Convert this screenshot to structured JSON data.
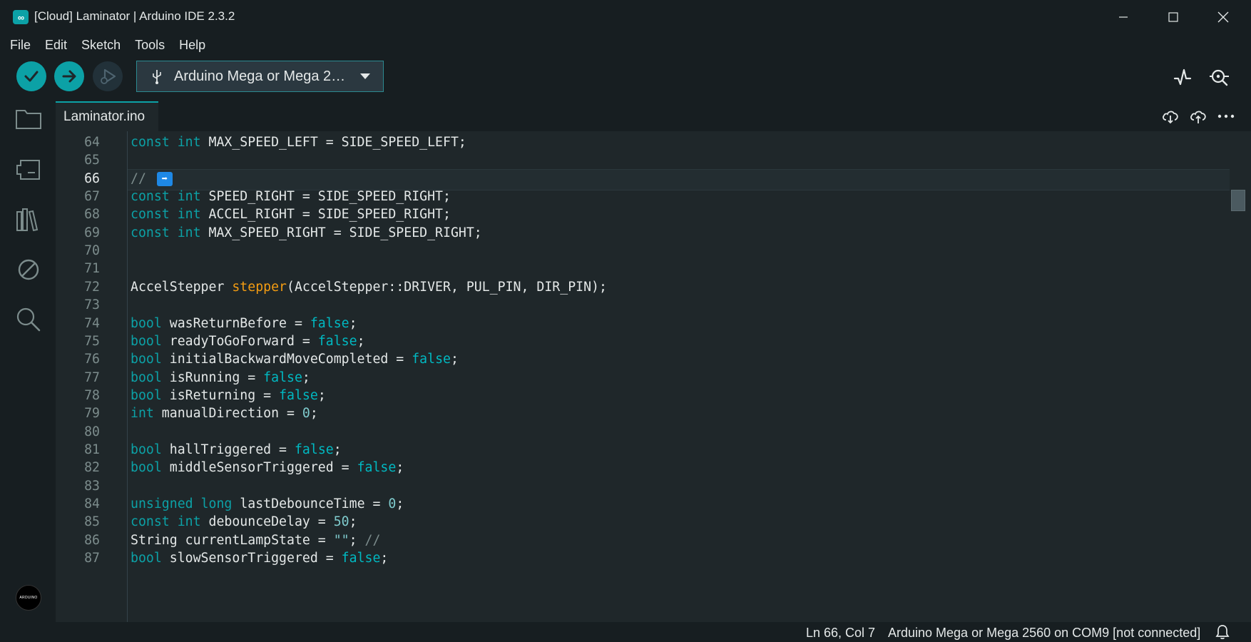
{
  "window": {
    "title": "[Cloud] Laminator | Arduino IDE 2.3.2",
    "app_icon_glyph": "∞"
  },
  "menu": [
    "File",
    "Edit",
    "Sketch",
    "Tools",
    "Help"
  ],
  "toolbar": {
    "board_label": "Arduino Mega or Mega 2…",
    "verify_icon": "check-icon",
    "upload_icon": "arrow-right-icon",
    "debug_icon": "debug-icon",
    "accent_color": "#0ca1a6"
  },
  "sidebar": {
    "items": [
      "folder-icon",
      "board-manager-icon",
      "library-manager-icon",
      "debug-disabled-icon",
      "search-icon"
    ],
    "avatar_text": "ARDUINO"
  },
  "tabs": [
    {
      "label": "Laminator.ino"
    }
  ],
  "editor": {
    "current_line": 66,
    "lines": [
      {
        "n": "64",
        "tokens": [
          [
            "kw",
            "const"
          ],
          [
            "pl",
            " "
          ],
          [
            "kw",
            "int"
          ],
          [
            "pl",
            " MAX_SPEED_LEFT = SIDE_SPEED_LEFT;"
          ]
        ]
      },
      {
        "n": "65",
        "tokens": []
      },
      {
        "n": "66",
        "tokens": [
          [
            "cm",
            "// "
          ]
        ],
        "emoji": "➡"
      },
      {
        "n": "67",
        "tokens": [
          [
            "kw",
            "const"
          ],
          [
            "pl",
            " "
          ],
          [
            "kw",
            "int"
          ],
          [
            "pl",
            " SPEED_RIGHT = SIDE_SPEED_RIGHT;"
          ]
        ]
      },
      {
        "n": "68",
        "tokens": [
          [
            "kw",
            "const"
          ],
          [
            "pl",
            " "
          ],
          [
            "kw",
            "int"
          ],
          [
            "pl",
            " ACCEL_RIGHT = SIDE_SPEED_RIGHT;"
          ]
        ]
      },
      {
        "n": "69",
        "tokens": [
          [
            "kw",
            "const"
          ],
          [
            "pl",
            " "
          ],
          [
            "kw",
            "int"
          ],
          [
            "pl",
            " MAX_SPEED_RIGHT = SIDE_SPEED_RIGHT;"
          ]
        ]
      },
      {
        "n": "70",
        "tokens": []
      },
      {
        "n": "71",
        "tokens": []
      },
      {
        "n": "72",
        "tokens": [
          [
            "pl",
            "AccelStepper "
          ],
          [
            "fn",
            "stepper"
          ],
          [
            "pl",
            "(AccelStepper::DRIVER, PUL_PIN, DIR_PIN);"
          ]
        ]
      },
      {
        "n": "73",
        "tokens": []
      },
      {
        "n": "74",
        "tokens": [
          [
            "kw",
            "bool"
          ],
          [
            "pl",
            " wasReturnBefore = "
          ],
          [
            "lit",
            "false"
          ],
          [
            "pl",
            ";"
          ]
        ]
      },
      {
        "n": "75",
        "tokens": [
          [
            "kw",
            "bool"
          ],
          [
            "pl",
            " readyToGoForward = "
          ],
          [
            "lit",
            "false"
          ],
          [
            "pl",
            ";"
          ]
        ]
      },
      {
        "n": "76",
        "tokens": [
          [
            "kw",
            "bool"
          ],
          [
            "pl",
            " initialBackwardMoveCompleted = "
          ],
          [
            "lit",
            "false"
          ],
          [
            "pl",
            ";"
          ]
        ]
      },
      {
        "n": "77",
        "tokens": [
          [
            "kw",
            "bool"
          ],
          [
            "pl",
            " isRunning = "
          ],
          [
            "lit",
            "false"
          ],
          [
            "pl",
            ";"
          ]
        ]
      },
      {
        "n": "78",
        "tokens": [
          [
            "kw",
            "bool"
          ],
          [
            "pl",
            " isReturning = "
          ],
          [
            "lit",
            "false"
          ],
          [
            "pl",
            ";"
          ]
        ]
      },
      {
        "n": "79",
        "tokens": [
          [
            "kw",
            "int"
          ],
          [
            "pl",
            " manualDirection = "
          ],
          [
            "num",
            "0"
          ],
          [
            "pl",
            ";"
          ]
        ]
      },
      {
        "n": "80",
        "tokens": []
      },
      {
        "n": "81",
        "tokens": [
          [
            "kw",
            "bool"
          ],
          [
            "pl",
            " hallTriggered = "
          ],
          [
            "lit",
            "false"
          ],
          [
            "pl",
            ";"
          ]
        ]
      },
      {
        "n": "82",
        "tokens": [
          [
            "kw",
            "bool"
          ],
          [
            "pl",
            " middleSensorTriggered = "
          ],
          [
            "lit",
            "false"
          ],
          [
            "pl",
            ";"
          ]
        ]
      },
      {
        "n": "83",
        "tokens": []
      },
      {
        "n": "84",
        "tokens": [
          [
            "kw",
            "unsigned"
          ],
          [
            "pl",
            " "
          ],
          [
            "kw",
            "long"
          ],
          [
            "pl",
            " lastDebounceTime = "
          ],
          [
            "num",
            "0"
          ],
          [
            "pl",
            ";"
          ]
        ]
      },
      {
        "n": "85",
        "tokens": [
          [
            "kw",
            "const"
          ],
          [
            "pl",
            " "
          ],
          [
            "kw",
            "int"
          ],
          [
            "pl",
            " debounceDelay = "
          ],
          [
            "num",
            "50"
          ],
          [
            "pl",
            ";"
          ]
        ]
      },
      {
        "n": "86",
        "tokens": [
          [
            "pl",
            "String currentLampState = "
          ],
          [
            "str",
            "\"\""
          ],
          [
            "pl",
            "; "
          ],
          [
            "cm",
            "//"
          ]
        ]
      },
      {
        "n": "87",
        "tokens": [
          [
            "kw",
            "bool"
          ],
          [
            "pl",
            " slowSensorTriggered = "
          ],
          [
            "lit",
            "false"
          ],
          [
            "pl",
            ";"
          ]
        ]
      }
    ]
  },
  "status": {
    "position": "Ln 66, Col 7",
    "board": "Arduino Mega or Mega 2560 on COM9 [not connected]"
  }
}
